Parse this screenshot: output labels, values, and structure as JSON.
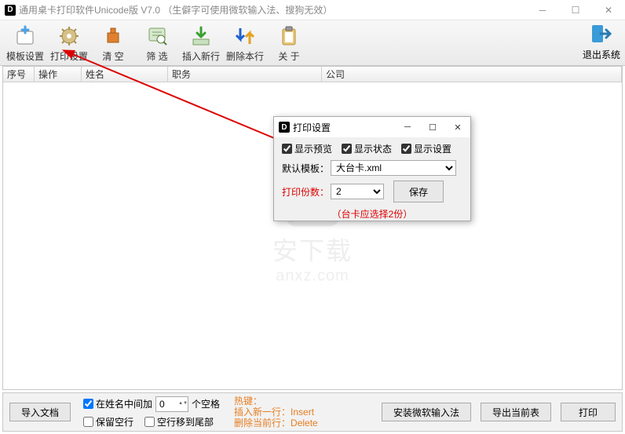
{
  "titlebar": {
    "title": "通用桌卡打印软件Unicode版   V7.0 （生僻字可使用微软输入法、搜狗无效）"
  },
  "toolbar": {
    "template": "模板设置",
    "print": "打印设置",
    "clear": "清    空",
    "filter": "筛    选",
    "insert": "插入新行",
    "delete": "删除本行",
    "about": "关    于",
    "exit": "退出系统"
  },
  "table": {
    "col1": "序号",
    "col2": "操作",
    "col3": "姓名",
    "col4": "职务",
    "col5": "公司"
  },
  "dialog": {
    "title": "打印设置",
    "cb_preview": "显示预览",
    "cb_status": "显示状态",
    "cb_settings": "显示设置",
    "default_template_label": "默认模板：",
    "default_template_value": "大台卡.xml",
    "copies_label": "打印份数：",
    "copies_value": "2",
    "save": "保存",
    "note": "（台卡应选择2份）"
  },
  "bottom": {
    "import": "导入文档",
    "cb_addspace": "在姓名中间加",
    "spin_value": "0",
    "space_suffix": "个空格",
    "cb_keepblank": "保留空行",
    "cb_blanktoend": "空行移到尾部",
    "hotkeys_title": "热键：",
    "hotkeys_insert": "插入新一行：Insert",
    "hotkeys_delete": "删除当前行：Delete",
    "install_ime": "安装微软输入法",
    "export": "导出当前表",
    "print": "打印"
  },
  "watermark": {
    "txt": "安下载",
    "sub": "anxz.com"
  }
}
